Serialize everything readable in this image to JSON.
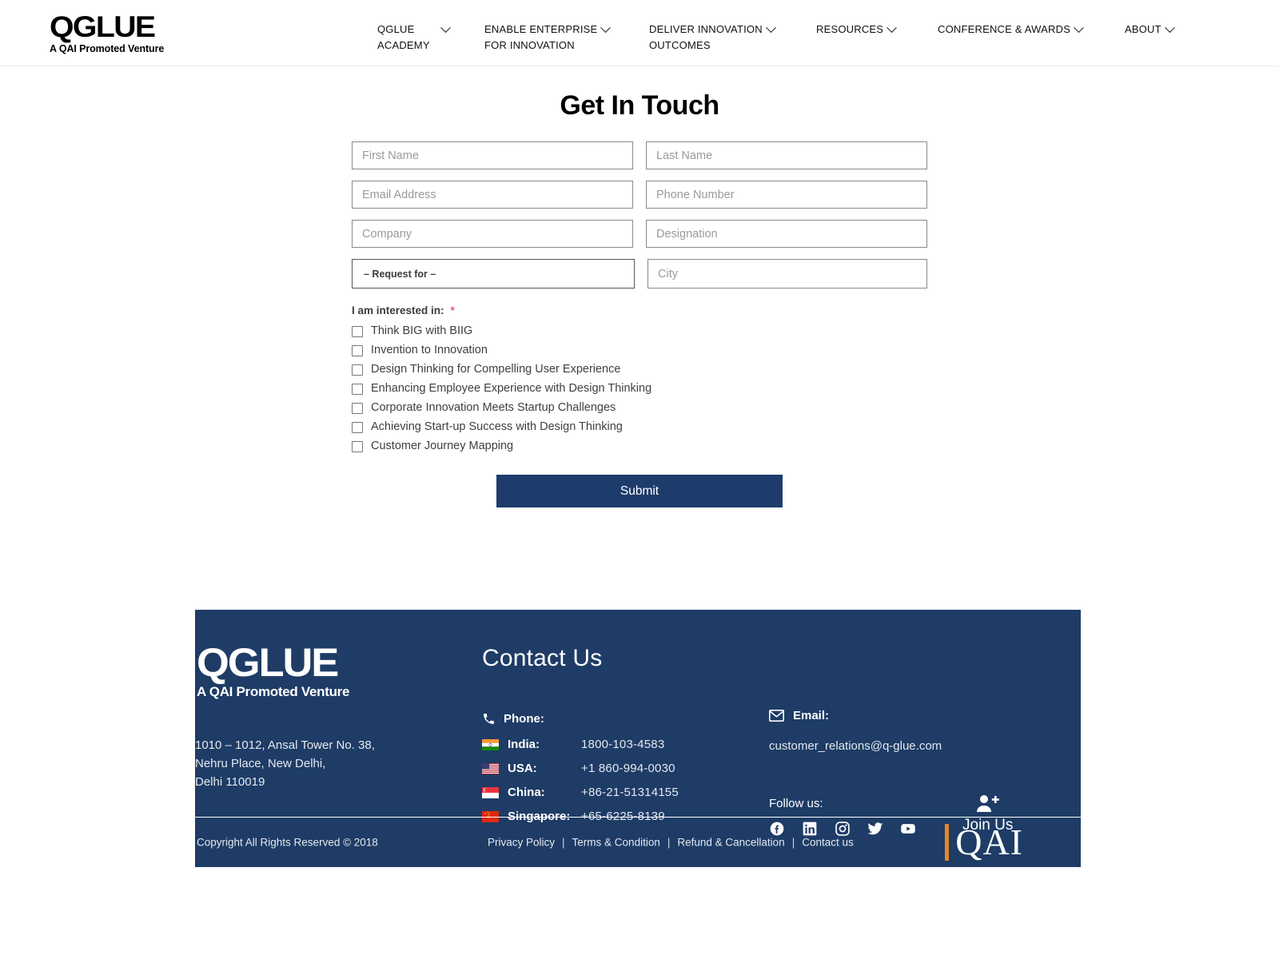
{
  "header": {
    "logo": {
      "word": "QGLUE",
      "tagline": "A QAI Promoted Venture"
    },
    "nav": [
      {
        "line1": "QGLUE",
        "line2": "ACADEMY",
        "caret": "chevron-down-icon",
        "far": true
      },
      {
        "line1": "ENABLE ENTERPRISE",
        "line2": "FOR INNOVATION",
        "caret": "chevron-down-icon",
        "far": false
      },
      {
        "line1": "DELIVER INNOVATION",
        "line2": "OUTCOMES",
        "caret": "chevron-down-icon",
        "far": false
      },
      {
        "line1": "RESOURCES",
        "line2": "",
        "caret": "chevron-down-icon",
        "far": false
      },
      {
        "line1": "CONFERENCE & AWARDS",
        "line2": "",
        "caret": "chevron-down-icon",
        "far": false
      },
      {
        "line1": "ABOUT",
        "line2": "",
        "caret": "chevron-down-icon",
        "far": false
      }
    ]
  },
  "main": {
    "title": "Get In Touch",
    "fields": {
      "first_name": {
        "placeholder": "First Name",
        "value": ""
      },
      "last_name": {
        "placeholder": "Last Name",
        "value": ""
      },
      "email": {
        "placeholder": "Email Address",
        "value": ""
      },
      "phone": {
        "placeholder": "Phone Number",
        "value": ""
      },
      "company": {
        "placeholder": "Company",
        "value": ""
      },
      "designation": {
        "placeholder": "Designation",
        "value": ""
      },
      "request_for": {
        "selected": "– Request for –"
      },
      "city": {
        "placeholder": "City",
        "value": ""
      }
    },
    "interest": {
      "label": "I am interested in:",
      "required_marker": "*",
      "options": [
        "Think BIG with BIIG",
        "Invention to Innovation",
        "Design Thinking for Compelling User Experience",
        "Enhancing Employee Experience with Design Thinking",
        "Corporate Innovation Meets Startup Challenges",
        "Achieving Start-up Success with Design Thinking",
        "Customer Journey Mapping"
      ]
    },
    "submit_label": "Submit"
  },
  "footer": {
    "logo": {
      "word": "QGLUE",
      "tagline": "A QAI Promoted Venture"
    },
    "address": [
      "1010 – 1012, Ansal Tower No. 38,",
      "Nehru Place, New Delhi,",
      "Delhi 110019"
    ],
    "contact_title": "Contact Us",
    "phone": {
      "icon": "phone-icon",
      "label": "Phone:",
      "entries": [
        {
          "flag": "india-flag-icon",
          "country": "India:",
          "number": "1800-103-4583"
        },
        {
          "flag": "usa-flag-icon",
          "country": "USA:",
          "number": "+1 860-994-0030"
        },
        {
          "flag": "singapore-flag-icon",
          "country": "China:",
          "number": "+86-21-51314155"
        },
        {
          "flag": "china-flag-icon",
          "country": "Singapore:",
          "number": "+65-6225-8139"
        }
      ]
    },
    "email": {
      "icon": "envelope-icon",
      "label": "Email:",
      "address": "customer_relations@q-glue.com"
    },
    "follow": {
      "label": "Follow us:",
      "socials": [
        "facebook-icon",
        "linkedin-icon",
        "instagram-icon",
        "twitter-icon",
        "youtube-icon"
      ]
    },
    "join": {
      "icon": "user-plus-icon",
      "label": "Join Us"
    },
    "copyright": "Copyright All Rights Reserved © 2018",
    "legal": [
      "Privacy Policy",
      "Terms & Condition",
      "Refund & Cancellation",
      "Contact us"
    ],
    "separator": "|",
    "qai_logo_text": "QAI"
  },
  "colors": {
    "brand_navy": "#1e3c66",
    "accent_orange": "#e2872c",
    "required_red": "#e8576f"
  }
}
